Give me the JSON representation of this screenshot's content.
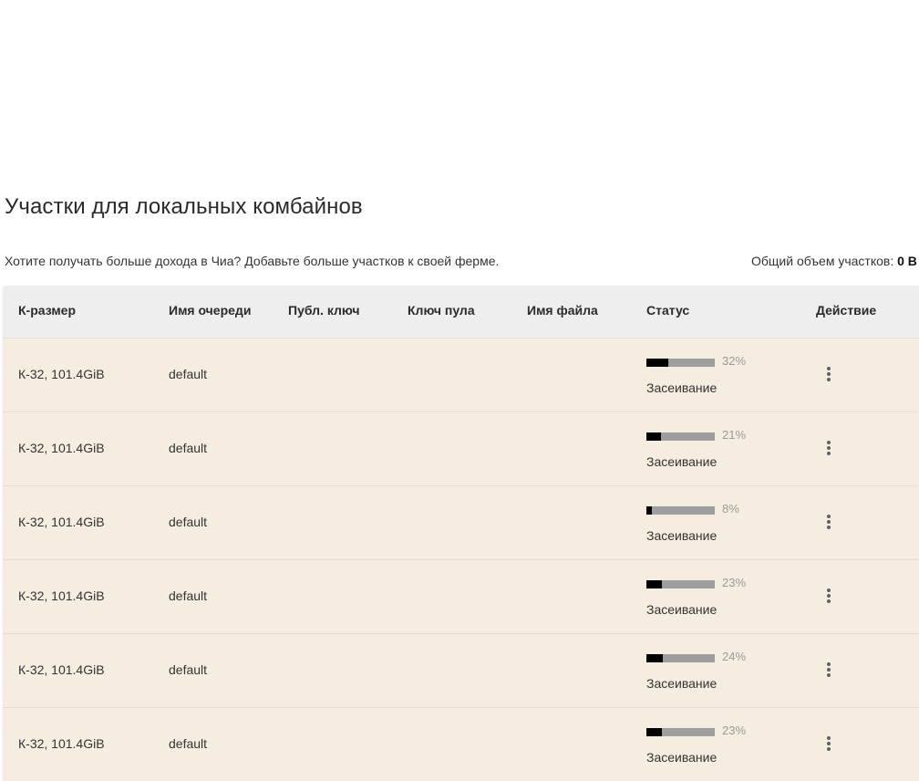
{
  "section": {
    "title": "Участки для локальных комбайнов",
    "promo": "Хотите получать больше дохода в Чиа? Добавьте больше участков к своей ферме.",
    "total_label": "Общий объем участков: ",
    "total_value": "0 B"
  },
  "table": {
    "headers": {
      "ksize": "К-размер",
      "queue": "Имя очереди",
      "pubkey": "Публ. ключ",
      "poolkey": "Ключ пула",
      "filename": "Имя файла",
      "status": "Статус",
      "action": "Действие"
    },
    "rows": [
      {
        "ksize": "К-32, 101.4GiB",
        "queue": "default",
        "progress": 32,
        "progress_label": "32%",
        "status": "Засеивание"
      },
      {
        "ksize": "К-32, 101.4GiB",
        "queue": "default",
        "progress": 21,
        "progress_label": "21%",
        "status": "Засеивание"
      },
      {
        "ksize": "К-32, 101.4GiB",
        "queue": "default",
        "progress": 8,
        "progress_label": "8%",
        "status": "Засеивание"
      },
      {
        "ksize": "К-32, 101.4GiB",
        "queue": "default",
        "progress": 23,
        "progress_label": "23%",
        "status": "Засеивание"
      },
      {
        "ksize": "К-32, 101.4GiB",
        "queue": "default",
        "progress": 24,
        "progress_label": "24%",
        "status": "Засеивание"
      },
      {
        "ksize": "К-32, 101.4GiB",
        "queue": "default",
        "progress": 23,
        "progress_label": "23%",
        "status": "Засеивание"
      }
    ]
  },
  "colors": {
    "row_bg": "#f5ede0",
    "header_bg": "#eeeeee",
    "progress_fill": "#000000",
    "progress_track": "#9e9e9e"
  },
  "icons": {
    "action": "more-vert-icon"
  }
}
